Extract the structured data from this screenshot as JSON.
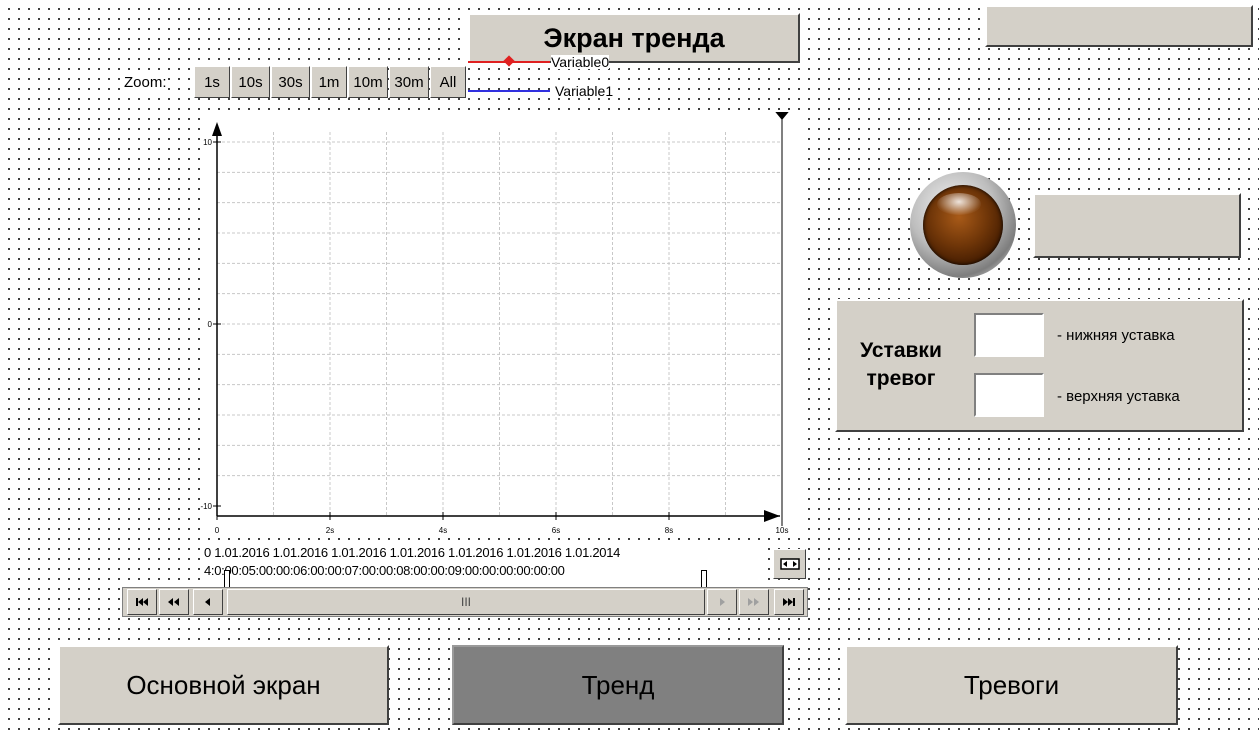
{
  "header": {
    "title": "Экран тренда"
  },
  "zoom": {
    "label": "Zoom:",
    "options": [
      "1s",
      "10s",
      "30s",
      "1m",
      "10m",
      "30m",
      "All"
    ]
  },
  "legend": [
    {
      "name": "Variable0",
      "color": "#e02020"
    },
    {
      "name": "Variable1",
      "color": "#3030e0"
    }
  ],
  "chart_data": {
    "type": "line",
    "title": "",
    "xlabel": "",
    "ylabel": "",
    "ylim": [
      -10,
      10
    ],
    "xlim": [
      0,
      10
    ],
    "y_ticks": [
      "10",
      "0",
      "-10"
    ],
    "x_ticks": [
      "0",
      "2s",
      "4s",
      "6s",
      "8s",
      "10s"
    ],
    "grid": true,
    "series": [
      {
        "name": "Variable0",
        "color": "#e02020",
        "values": []
      },
      {
        "name": "Variable1",
        "color": "#3030e0",
        "values": []
      }
    ]
  },
  "time_axis": {
    "row1": "0 1.01.2016 1.01.2016 1.01.2016 1.01.2016 1.01.2016 1.01.2016 1.01.2014",
    "row2": "4:0:00:05:00:00:06:00:00:07:00:00:08:00:00:09:00:00:00:00:00:00"
  },
  "scrollbar": {
    "first_icon": "skip-to-start-icon",
    "fast_back_icon": "fast-rewind-icon",
    "back_icon": "step-back-icon",
    "thumb_grip": "III",
    "forward_icon": "step-forward-icon",
    "fast_forward_icon": "fast-forward-icon",
    "last_icon": "skip-to-end-icon"
  },
  "alarm_setpoints": {
    "title_line1": "Уставки",
    "title_line2": "тревог",
    "lower_label": "- нижняя уставка",
    "upper_label": "- верхняя уставка",
    "lower_value": "",
    "upper_value": ""
  },
  "nav": {
    "main_label": "Основной экран",
    "trend_label": "Тренд",
    "alarms_label": "Тревоги"
  },
  "colors": {
    "panel": "#d4d0c8",
    "active_nav": "#808080",
    "lamp": "#6e3508"
  }
}
